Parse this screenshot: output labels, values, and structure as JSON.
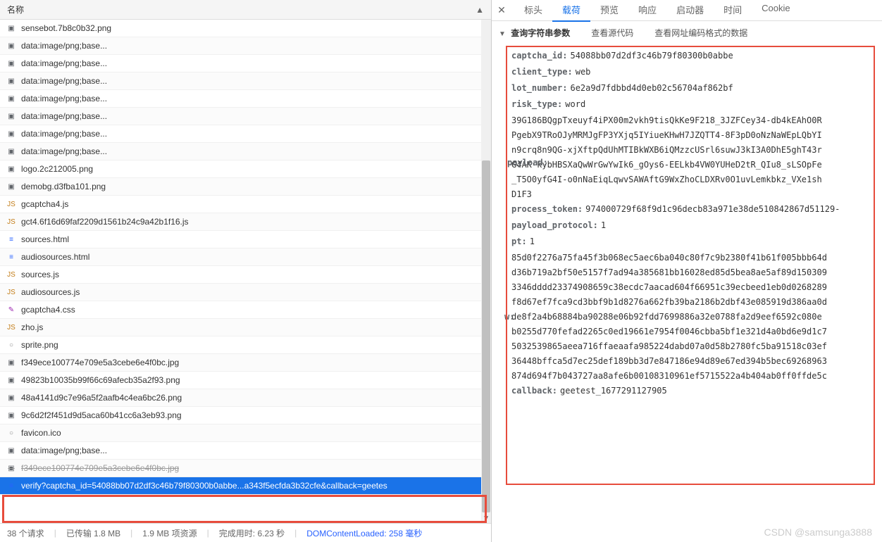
{
  "leftPanel": {
    "header": "名称",
    "files": [
      {
        "icon": "image",
        "name": "sensebot.7b8c0b32.png"
      },
      {
        "icon": "image",
        "name": "data:image/png;base..."
      },
      {
        "icon": "image",
        "name": "data:image/png;base..."
      },
      {
        "icon": "image",
        "name": "data:image/png;base..."
      },
      {
        "icon": "image",
        "name": "data:image/png;base..."
      },
      {
        "icon": "image",
        "name": "data:image/png;base..."
      },
      {
        "icon": "image",
        "name": "data:image/png;base..."
      },
      {
        "icon": "image",
        "name": "data:image/png;base..."
      },
      {
        "icon": "image",
        "name": "logo.2c212005.png"
      },
      {
        "icon": "image",
        "name": "demobg.d3fba101.png"
      },
      {
        "icon": "js",
        "name": "gcaptcha4.js"
      },
      {
        "icon": "js",
        "name": "gct4.6f16d69faf2209d1561b24c9a42b1f16.js"
      },
      {
        "icon": "html",
        "name": "sources.html"
      },
      {
        "icon": "html",
        "name": "audiosources.html"
      },
      {
        "icon": "js",
        "name": "sources.js"
      },
      {
        "icon": "js",
        "name": "audiosources.js"
      },
      {
        "icon": "css",
        "name": "gcaptcha4.css"
      },
      {
        "icon": "js",
        "name": "zho.js"
      },
      {
        "icon": "generic",
        "name": "sprite.png"
      },
      {
        "icon": "image",
        "name": "f349ece100774e709e5a3cebe6e4f0bc.jpg"
      },
      {
        "icon": "image",
        "name": "49823b10035b99f66c69afecb35a2f93.png"
      },
      {
        "icon": "image",
        "name": "48a4141d9c7e96a5f2aafb4c4ea6bc26.png"
      },
      {
        "icon": "image",
        "name": "9c6d2f2f451d9d5aca60b41cc6a3eb93.png"
      },
      {
        "icon": "generic",
        "name": "favicon.ico"
      },
      {
        "icon": "image",
        "name": "data:image/png;base..."
      },
      {
        "icon": "image",
        "name": "f349ece100774e709e5a3cebe6e4f0bc.jpg",
        "strike": true
      },
      {
        "icon": "html",
        "name": "verify?captcha_id=54088bb07d2df3c46b79f80300b0abbe...a343f5ecfda3b32cfe&callback=geetes",
        "selected": true
      }
    ]
  },
  "statusBar": {
    "requests": "38 个请求",
    "transferred": "已传输 1.8 MB",
    "resources": "1.9 MB 项资源",
    "finish": "完成用时: 6.23 秒",
    "domLoaded": "DOMContentLoaded: 258 毫秒"
  },
  "rightPanel": {
    "tabs": [
      "标头",
      "载荷",
      "预览",
      "响应",
      "启动器",
      "时间",
      "Cookie"
    ],
    "activeTab": 1,
    "section": {
      "title": "查询字符串参数",
      "viewSource": "查看源代码",
      "viewUrlEncoded": "查看网址编码格式的数据"
    },
    "params": {
      "captcha_id": "54088bb07d2df3c46b79f80300b0abbe",
      "client_type": "web",
      "lot_number": "6e2a9d7fdbbd4d0eb02c56704af862bf",
      "risk_type": "word",
      "payload_lines": [
        "39G186BQgpTxeuyf4iPX00m2vkh9tisQkKe9F218_3JZFCey34-db4kEAhO0R",
        "PgebX9TRoOJyMRMJgFP3YXjq5IYiueKHwH7JZQTT4-8F3pD0oNzNaWEpLQbYI",
        "n9crq8n9QG-xjXftpQdUhMTIBkWXB6iQMzzcUSrl6suwJ3kI3A0DhE5ghT43r",
        "G4AK-kybHBSXaQwWrGwYwIk6_gOys6-EELkb4VW0YUHeD2tR_QIu8_sLSOpFe",
        "_T5O0yfG4I-o0nNaEiqLqwvSAWAftG9WxZhoCLDXRv0O1uvLemkbkz_VXe1sh",
        "D1F3"
      ],
      "process_token": "974000729f68f9d1c96decb83a971e38de510842867d51129-",
      "payload_protocol": "1",
      "pt": "1",
      "w_lines": [
        "85d0f2276a75fa45f3b068ec5aec6ba040c80f7c9b2380f41b61f005bbb64d",
        "d36b719a2bf50e5157f7ad94a385681bb16028ed85d5bea8ae5af89d150309",
        "3346dddd23374908659c38ecdc7aacad604f66951c39ecbeed1eb0d0268289",
        "f8d67ef7fca9cd3bbf9b1d8276a662fb39ba2186b2dbf43e085919d386aa0d",
        "de8f2a4b68884ba90288e06b92fdd7699886a32e0788fa2d9eef6592c080e",
        "b0255d770fefad2265c0ed19661e7954f0046cbba5bf1e321d4a0bd6e9d1c7",
        "5032539865aeea716ffaeaafa985224dabd07a0d58b2780fc5ba91518c03ef",
        "36448bffca5d7ec25def189bb3d7e847186e94d89e67ed394b5bec69268963",
        "874d694f7b043727aa8afe6b00108310961ef5715522a4b404ab0ff0ffde5c"
      ],
      "callback": "geetest_1677291127905"
    }
  },
  "watermark": "CSDN @samsunga3888"
}
